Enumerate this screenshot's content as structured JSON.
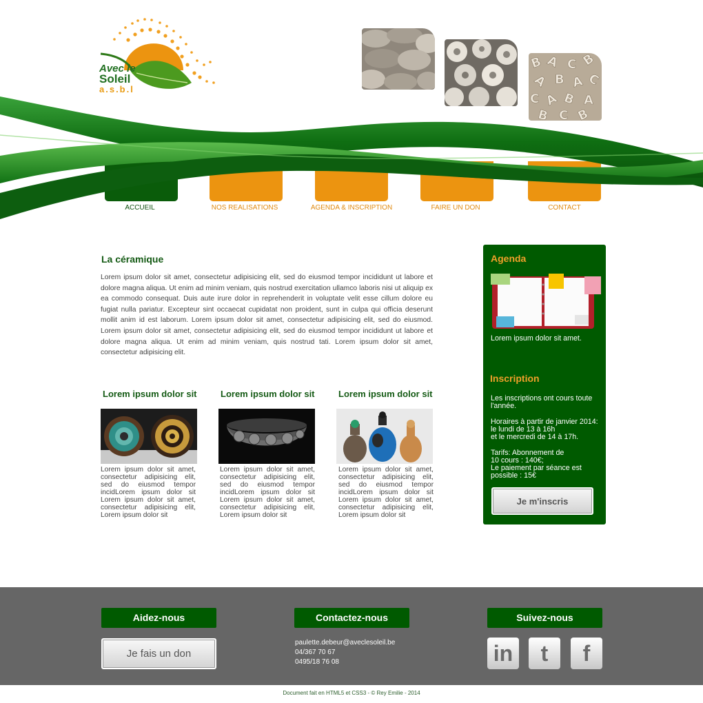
{
  "logo": {
    "line1": "Avec le",
    "line2": "Soleil",
    "line3": "a.s.b.l"
  },
  "nav": [
    {
      "label": "ACCUEIL",
      "active": true
    },
    {
      "label": "NOS REALISATIONS",
      "active": false
    },
    {
      "label": "AGENDA & INSCRIPTION",
      "active": false
    },
    {
      "label": "FAIRE UN DON",
      "active": false
    },
    {
      "label": "CONTACT",
      "active": false
    }
  ],
  "main": {
    "title": "La céramique",
    "paragraph": "Lorem ipsum dolor sit amet, consectetur adipisicing elit, sed do eiusmod tempor incididunt ut labore et dolore magna aliqua. Ut enim ad minim veniam, quis nostrud exercitation ullamco laboris nisi ut aliquip ex ea commodo consequat. Duis aute irure dolor in reprehenderit in voluptate velit esse cillum dolore eu fugiat nulla pariatur. Excepteur sint occaecat cupidatat non proident, sunt in culpa qui officia deserunt mollit anim id est laborum. Lorem ipsum dolor sit amet, consectetur adipisicing elit, sed do eiusmod. Lorem ipsum dolor sit amet, consectetur adipisicing elit, sed do eiusmod tempor incididunt ut labore et dolore magna aliqua. Ut enim ad minim veniam, quis nostrud tati. Lorem ipsum dolor sit amet, consectetur adipisicing elit.",
    "columns": [
      {
        "title": "Lorem ipsum dolor sit",
        "text": "Lorem ipsum dolor sit amet, consectetur adipisicing elit, sed do eiusmod tempor incidLorem ipsum dolor sit Lorem ipsum dolor sit amet, consectetur adipisicing elit, Lorem ipsum dolor sit"
      },
      {
        "title": "Lorem ipsum dolor sit",
        "text": "Lorem ipsum dolor sit amet, consectetur adipisicing elit, sed do eiusmod tempor incidLorem ipsum dolor sit Lorem ipsum dolor sit amet, consectetur adipisicing elit, Lorem ipsum dolor sit"
      },
      {
        "title": "Lorem ipsum dolor sit",
        "text": "Lorem ipsum dolor sit amet, consectetur adipisicing elit, sed do eiusmod tempor incidLorem ipsum dolor sit Lorem ipsum dolor sit amet, consectetur adipisicing elit, Lorem ipsum dolor sit"
      }
    ]
  },
  "sidebar": {
    "agenda_title": "Agenda",
    "agenda_caption": "Lorem ipsum dolor sit amet.",
    "inscription_title": "Inscription",
    "p1": "Les inscriptions ont cours toute l'année.",
    "p2a": "Horaires à partir de janvier 2014: le lundi de 13 à 16h",
    "p2b": "et le mercredi de 14 à 17h.",
    "p3a": "Tarifs: Abonnement de",
    "p3b": "10 cours : 140€;",
    "p3c": "Le paiement par séance est possible : 15€",
    "button": "Je m'inscris"
  },
  "footer": {
    "help_title": "Aidez-nous",
    "donate_button": "Je fais un don",
    "contact_title": "Contactez-nous",
    "email": "paulette.debeur@aveclesoleil.be",
    "phone1": "04/367 70 67",
    "phone2": "0495/18 76 08",
    "follow_title": "Suivez-nous",
    "social_linkedin": "in",
    "social_twitter": "t",
    "social_facebook": "f",
    "copyright": "Document fait en HTML5 et CSS3 - © Rey Emilie - 2014"
  },
  "colors": {
    "green": "#005a00",
    "orange": "#ec9410",
    "footer": "#666666"
  },
  "icons": [
    "sun-icon",
    "leaf-icon",
    "linkedin-icon",
    "twitter-icon",
    "facebook-icon"
  ]
}
